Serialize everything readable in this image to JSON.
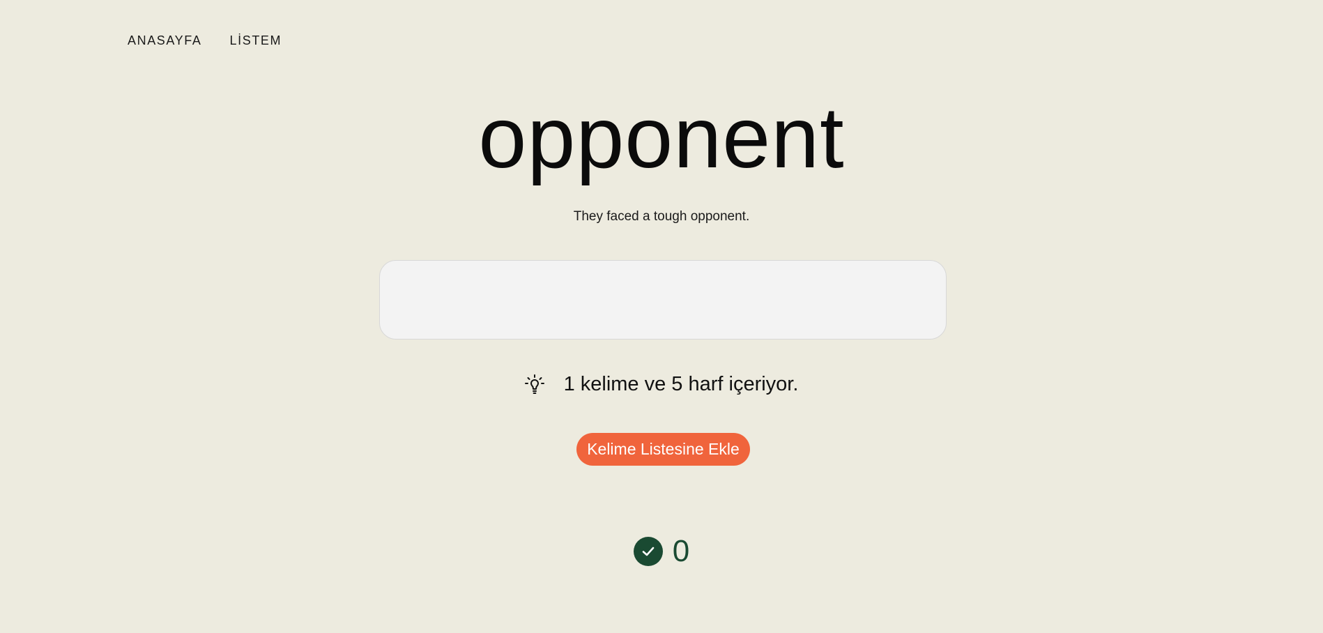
{
  "nav": {
    "items": [
      {
        "label": "ANASAYFA"
      },
      {
        "label": "LİSTEM"
      }
    ]
  },
  "card": {
    "word": "opponent",
    "example": "They faced a tough opponent.",
    "answer_value": "",
    "hint_icon": "lightbulb-icon",
    "hint": "1 kelime ve 5 harf içeriyor.",
    "add_button_label": "Kelime Listesine Ekle"
  },
  "score": {
    "icon": "check-circle-icon",
    "value": "0"
  },
  "colors": {
    "background": "#edebdf",
    "accent": "#f0643c",
    "success": "#1a4a32"
  }
}
